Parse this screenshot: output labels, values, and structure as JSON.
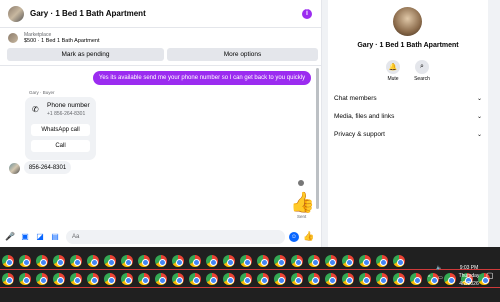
{
  "header": {
    "title": "Gary · 1 Bed 1 Bath Apartment",
    "info_icon": "info-icon"
  },
  "marketplace": {
    "label": "Marketplace",
    "listing": "$500 · 1 Bed 1 Bath Apartment",
    "mark_pending_label": "Mark as pending",
    "more_options_label": "More options"
  },
  "messages": {
    "outgoing_text": "Yes its available send me your phone number so I can get back to you quickly",
    "sender_label": "Gary · Buyer",
    "phone_card": {
      "title": "Phone number",
      "number": "+1 856-264-8301",
      "whatsapp_label": "WhatsApp call",
      "call_label": "Call"
    },
    "incoming_text": "856-264-8301",
    "sent_label": "Sent"
  },
  "composer": {
    "placeholder": "Aa"
  },
  "side_panel": {
    "title": "Gary · 1 Bed 1 Bath Apartment",
    "mute_label": "Mute",
    "search_label": "Search",
    "sections": [
      "Chat members",
      "Media, files and links",
      "Privacy & support"
    ]
  },
  "taskbar": {
    "time": "9:03 PM",
    "day": "Thursday",
    "date": "4/2/2026"
  },
  "colors": {
    "accent": "#9b2cf0",
    "messenger_blue": "#0866ff",
    "taskbar": "#202020"
  }
}
